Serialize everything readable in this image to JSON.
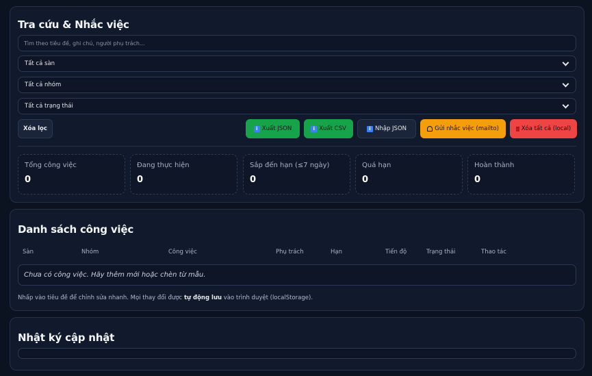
{
  "search_card": {
    "title": "Tra cứu & Nhắc việc",
    "search_placeholder": "Tìm theo tiêu đề, ghi chú, người phụ trách...",
    "filters": {
      "san": "Tất cả sàn",
      "nhom": "Tất cả nhóm",
      "trang_thai": "Tất cả trạng thái"
    },
    "buttons": {
      "clear": "Xóa lọc",
      "export_json": "Xuất JSON",
      "export_csv": "Xuất CSV",
      "import_json": "Nhập JSON",
      "remind": "Gửi nhắc việc (mailto)",
      "delete_all": "Xóa tất cả (local)"
    },
    "stats": [
      {
        "label": "Tổng công việc",
        "value": "0"
      },
      {
        "label": "Đang thực hiện",
        "value": "0"
      },
      {
        "label": "Sắp đến hạn (≤7 ngày)",
        "value": "0"
      },
      {
        "label": "Quá hạn",
        "value": "0"
      },
      {
        "label": "Hoàn thành",
        "value": "0"
      }
    ]
  },
  "list_card": {
    "title": "Danh sách công việc",
    "columns": [
      "Sàn",
      "Nhóm",
      "Công việc",
      "Phụ trách",
      "Hạn",
      "Tiến độ",
      "Trạng thái",
      "Thao tác"
    ],
    "empty_text": "Chưa có công việc. Hãy thêm mới hoặc chèn từ mẫu.",
    "hint_before": "Nhấp vào tiêu đề để chỉnh sửa nhanh. Mọi thay đổi được ",
    "hint_bold": "tự động lưu",
    "hint_after": " vào trình duyệt (localStorage)."
  },
  "log_card": {
    "title": "Nhật ký cập nhật"
  },
  "colors": {
    "background": "#0b1220",
    "card": "#111a2c",
    "green": "#16a34a",
    "amber": "#f59e0b",
    "red": "#ef4444"
  }
}
